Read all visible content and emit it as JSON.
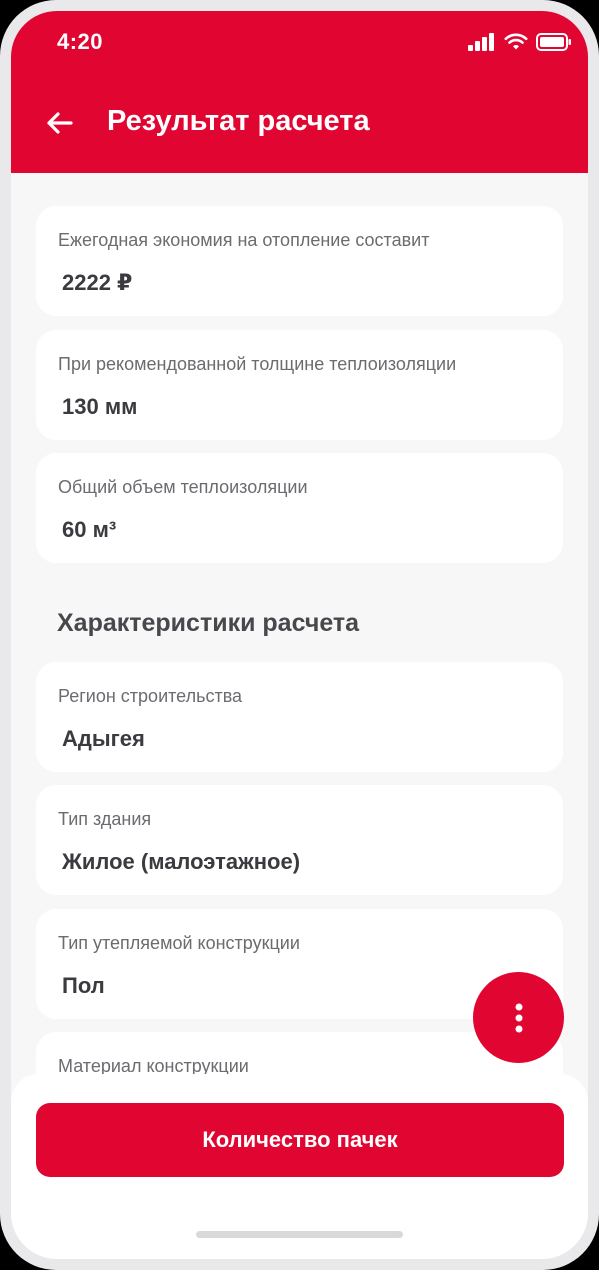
{
  "status_bar": {
    "time": "4:20"
  },
  "header": {
    "title": "Результат расчета",
    "back_icon": "arrow-left-icon",
    "color": "#e10531"
  },
  "results": [
    {
      "label": "Ежегодная экономия на отопление составит",
      "value": "2222 ₽"
    },
    {
      "label": "При рекомендованной толщине теплоизоляции",
      "value": "130 мм"
    },
    {
      "label": "Общий объем теплоизоляции",
      "value": "60 м³"
    }
  ],
  "characteristics": {
    "title": "Характеристики расчета",
    "items": [
      {
        "label": "Регион строительства",
        "value": "Адыгея"
      },
      {
        "label": "Тип здания",
        "value": "Жилое (малоэтажное)"
      },
      {
        "label": "Тип утепляемой конструкции",
        "value": "Пол"
      },
      {
        "label": "Материал конструкции",
        "value": ""
      }
    ]
  },
  "fab": {
    "icon": "more-vertical-icon"
  },
  "bottom": {
    "button_label": "Количество пачек"
  },
  "colors": {
    "accent": "#e10531",
    "background": "#f7f7f8",
    "card": "#ffffff"
  }
}
